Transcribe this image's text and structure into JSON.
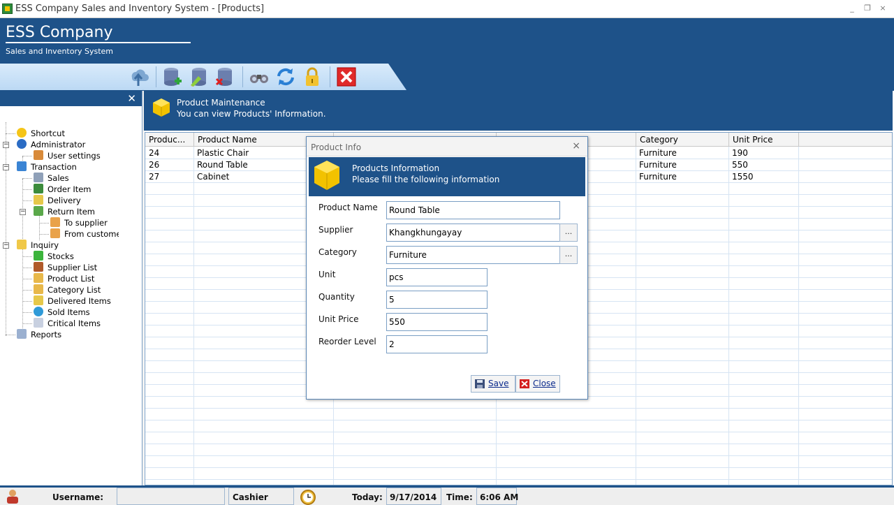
{
  "window": {
    "title": "ESS Company Sales and Inventory System - [Products]",
    "minimize": "_",
    "restore": "❐",
    "close": "×"
  },
  "header": {
    "company": "ESS Company",
    "subtitle": "Sales and Inventory System"
  },
  "toolbar": {
    "icons": [
      "upload-icon",
      "add-record-icon",
      "edit-record-icon",
      "delete-record-icon",
      "search-binoculars-icon",
      "refresh-icon",
      "lock-icon",
      "exit-icon"
    ]
  },
  "sidebar": {
    "close": "✕",
    "items": [
      {
        "label": "Shortcut",
        "icon": "shortcut-icon"
      },
      {
        "label": "Administrator",
        "icon": "administrator-icon"
      },
      {
        "label": "User settings",
        "icon": "user-settings-icon"
      },
      {
        "label": "Transaction",
        "icon": "transaction-icon"
      },
      {
        "label": "Sales",
        "icon": "sales-icon"
      },
      {
        "label": "Order Item",
        "icon": "order-item-icon"
      },
      {
        "label": "Delivery",
        "icon": "delivery-icon"
      },
      {
        "label": "Return Item",
        "icon": "return-item-icon"
      },
      {
        "label": "To supplier",
        "icon": "to-supplier-icon"
      },
      {
        "label": "From custome",
        "icon": "from-customer-icon"
      },
      {
        "label": "Inquiry",
        "icon": "inquiry-icon"
      },
      {
        "label": "Stocks",
        "icon": "stocks-icon"
      },
      {
        "label": "Supplier List",
        "icon": "supplier-list-icon"
      },
      {
        "label": "Product List",
        "icon": "product-list-icon"
      },
      {
        "label": "Category List",
        "icon": "category-list-icon"
      },
      {
        "label": "Delivered Items",
        "icon": "delivered-items-icon"
      },
      {
        "label": "Sold Items",
        "icon": "sold-items-icon"
      },
      {
        "label": "Critical Items",
        "icon": "critical-items-icon"
      },
      {
        "label": "Reports",
        "icon": "reports-icon"
      }
    ]
  },
  "banner": {
    "title": "Product Maintenance",
    "subtitle": "You can view Products' Information."
  },
  "grid": {
    "columns": [
      "Produc...",
      "Product Name",
      "",
      "",
      "Category",
      "Unit Price"
    ],
    "rows": [
      {
        "id": "24",
        "name": "Plastic Chair",
        "category": "Furniture",
        "price": "190"
      },
      {
        "id": "26",
        "name": "Round Table",
        "category": "Furniture",
        "price": "550"
      },
      {
        "id": "27",
        "name": "Cabinet",
        "category": "Furniture",
        "price": "1550"
      }
    ]
  },
  "dialog": {
    "title": "Product Info",
    "close": "×",
    "band_title": "Products Information",
    "band_subtitle": "Please fill the following information",
    "fields": {
      "product_name": {
        "label": "Product Name",
        "value": "Round Table"
      },
      "supplier": {
        "label": "Supplier",
        "value": "Khangkhungayay"
      },
      "category": {
        "label": "Category",
        "value": "Furniture"
      },
      "unit": {
        "label": "Unit",
        "value": "pcs"
      },
      "quantity": {
        "label": "Quantity",
        "value": "5"
      },
      "unit_price": {
        "label": "Unit Price",
        "value": "550"
      },
      "reorder_level": {
        "label": "Reorder Level",
        "value": "2"
      }
    },
    "browse": "...",
    "save": "Save",
    "close_button": "Close"
  },
  "status": {
    "username_label": "Username:",
    "username_value": "",
    "role": "Cashier",
    "today_label": "Today:",
    "date": "9/17/2014",
    "time_label": "Time:",
    "time": "6:06 AM"
  },
  "colors": {
    "header_blue": "#1e5289",
    "toolbar_light": "#d9ebfb"
  }
}
